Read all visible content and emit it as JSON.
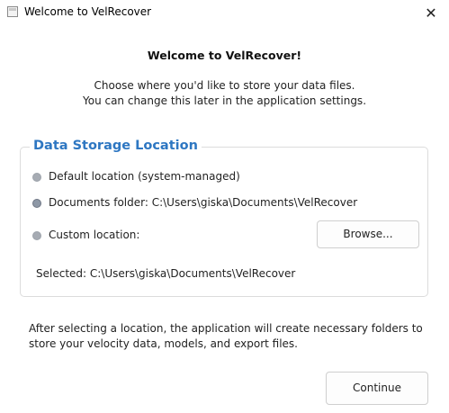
{
  "window": {
    "title": "Welcome to VelRecover",
    "close_glyph": "✕"
  },
  "header": {
    "title": "Welcome to VelRecover!",
    "intro_line1": "Choose where you'd like to store your data files.",
    "intro_line2": "You can change this later in the application settings."
  },
  "storage": {
    "group_title": "Data Storage Location",
    "options": [
      {
        "label": "Default location (system-managed)",
        "selected": false
      },
      {
        "label": "Documents folder: C:\\Users\\giska\\Documents\\VelRecover",
        "selected": true
      },
      {
        "label": "Custom location:",
        "selected": false
      }
    ],
    "browse_label": "Browse...",
    "selected_text": "Selected: C:\\Users\\giska\\Documents\\VelRecover"
  },
  "info": {
    "line1": "After selecting a location, the application will create necessary folders to",
    "line2": "store your velocity data, models, and export files."
  },
  "footer": {
    "continue_label": "Continue"
  },
  "colors": {
    "accent": "#2e77c2",
    "radio": "#a6abb3",
    "border": "#dcdcdc"
  }
}
